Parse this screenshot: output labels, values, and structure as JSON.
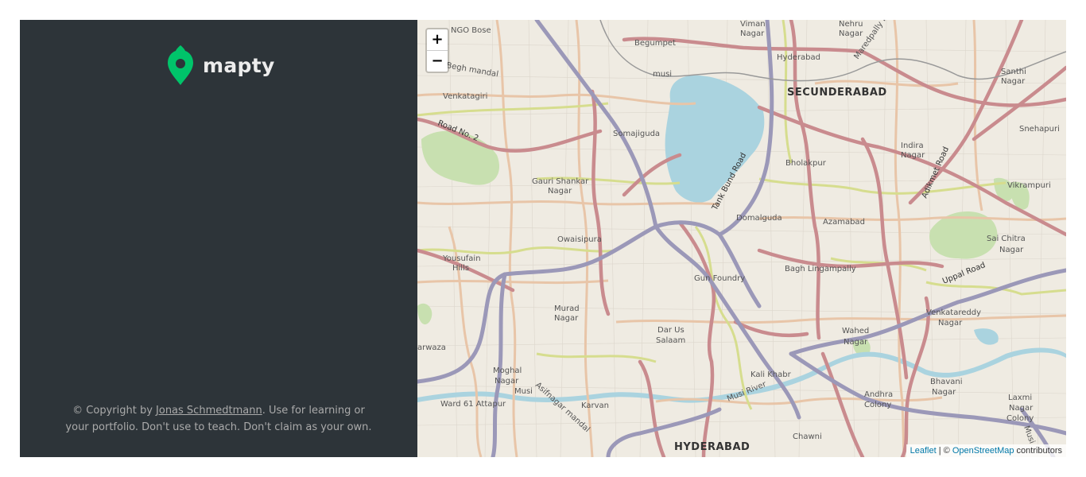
{
  "brand": {
    "name": "mapty",
    "accent": "#00c46a"
  },
  "footer": {
    "prefix": "© Copyright by ",
    "author": "Jonas Schmedtmann",
    "suffix": ". Use for learning or your portfolio. Don't use to teach. Don't claim as your own."
  },
  "map": {
    "zoom_in": "+",
    "zoom_out": "−",
    "attribution": {
      "leaflet": "Leaflet",
      "sep": " | © ",
      "osm": "OpenStreetMap",
      "tail": " contributors"
    },
    "labels": {
      "secunderabad": "SECUNDERABAD",
      "hyderabad": "HYDERABAD",
      "begumpet": "Begumpet",
      "viman_nagar_1": "Viman",
      "viman_nagar_2": "Nagar",
      "nehru_nagar_1": "Nehru",
      "nehru_nagar_2": "Nagar",
      "hyderabad_small": "Hyderabad",
      "santhi_1": "Santhi",
      "santhi_2": "Nagar",
      "venkatagiri": "Venkatagiri",
      "somajiguda": "Somajiguda",
      "snehapuri": "Snehapuri",
      "indira_1": "Indira",
      "indira_2": "Nagar",
      "bholakpur": "Bholakpur",
      "gauri_1": "Gauri Shankar",
      "gauri_2": "Nagar",
      "vikrampuri": "Vikrampuri",
      "domalguda": "Domalguda",
      "azamabad": "Azamabad",
      "owaisipura": "Owaisipura",
      "sai_1": "Sai Chitra",
      "sai_2": "Nagar",
      "yousufain_1": "Yousufain",
      "yousufain_2": "Hills",
      "gun_foundry": "Gun Foundry",
      "bagh": "Bagh Lingampally",
      "murad_1": "Murad",
      "murad_2": "Nagar",
      "venkatareddy_1": "Venkatareddy",
      "venkatareddy_2": "Nagar",
      "darus_1": "Dar Us",
      "darus_2": "Salaam",
      "wahed_1": "Wahed",
      "wahed_2": "Nagar",
      "arwaza": "arwaza",
      "moghal_1": "Moghal",
      "moghal_2": "Nagar",
      "kali_khabr": "Kali Khabr",
      "bhavani_1": "Bhavani",
      "bhavani_2": "Nagar",
      "musi_1": "Musi",
      "andhra_1": "Andhra",
      "andhra_2": "Colony",
      "laxmi_1": "Laxmi",
      "laxmi_2": "Nagar",
      "laxmi_3": "Colony",
      "ward61": "Ward 61 Attapur",
      "karvan": "Karvan",
      "chawni": "Chawni",
      "ngo_bose": "NGO Bose",
      "road_no2": "Road No. 2",
      "tank_bund": "Tank Bund Road",
      "adikmet": "Adikmet Road",
      "uppal": "Uppal Road",
      "asifnagar": "Asifnagar mandal",
      "musi_river": "Musi River",
      "musi_top": "musi",
      "begh_mandal": "Begh mandal",
      "maredpally": "Maredpally R",
      "musi_2": "Musi"
    },
    "colors": {
      "water": "#aad3df",
      "park": "#c8e0b0",
      "major_road": "#c98b8e",
      "motorway": "#9b98b8",
      "secondary": "#d6dd8e",
      "minor": "#e8c5a8"
    }
  }
}
